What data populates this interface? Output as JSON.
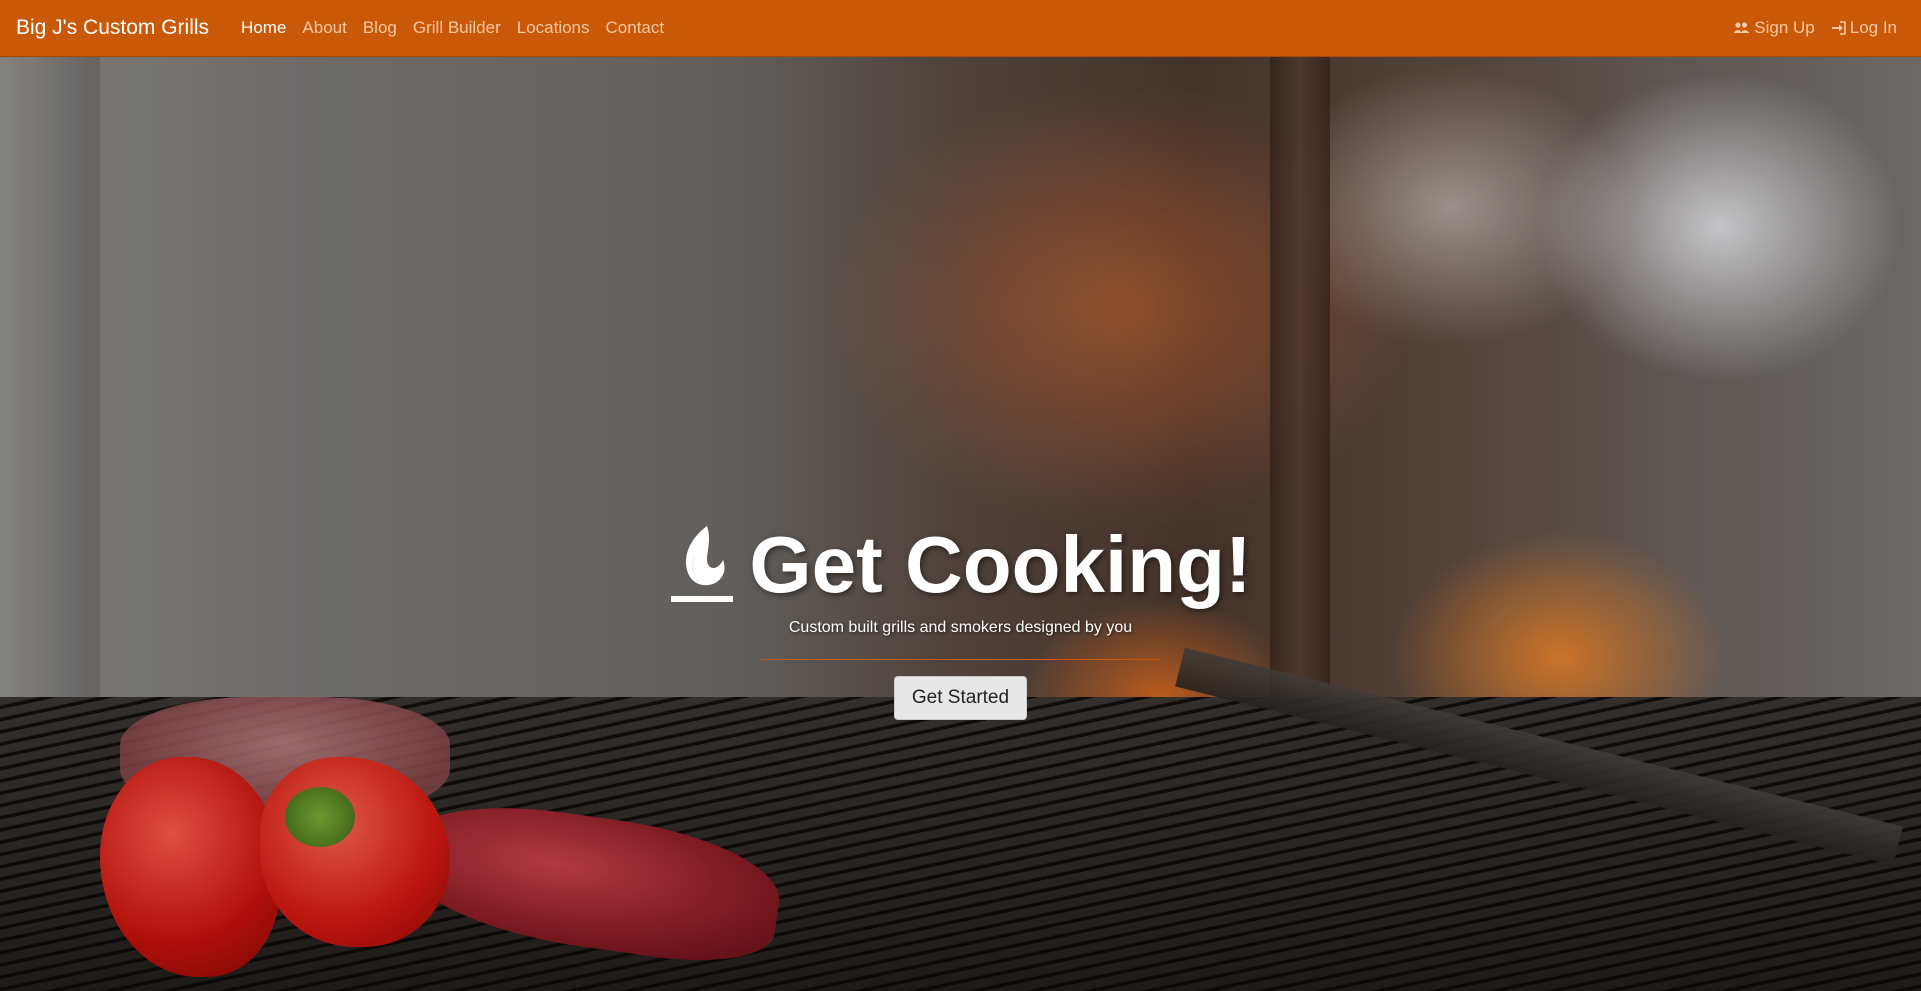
{
  "nav": {
    "brand": "Big J's Custom Grills",
    "links": [
      "Home",
      "About",
      "Blog",
      "Grill Builder",
      "Locations",
      "Contact"
    ],
    "active": "Home",
    "right": [
      {
        "label": "Sign Up",
        "icon": "users-icon"
      },
      {
        "label": "Log In",
        "icon": "sign-in-icon"
      }
    ]
  },
  "hero": {
    "icon": "flame-icon",
    "title": "Get Cooking!",
    "tagline": "Custom built grills and smokers designed by you",
    "button": "Get Started",
    "accent_color": "#c95808"
  }
}
